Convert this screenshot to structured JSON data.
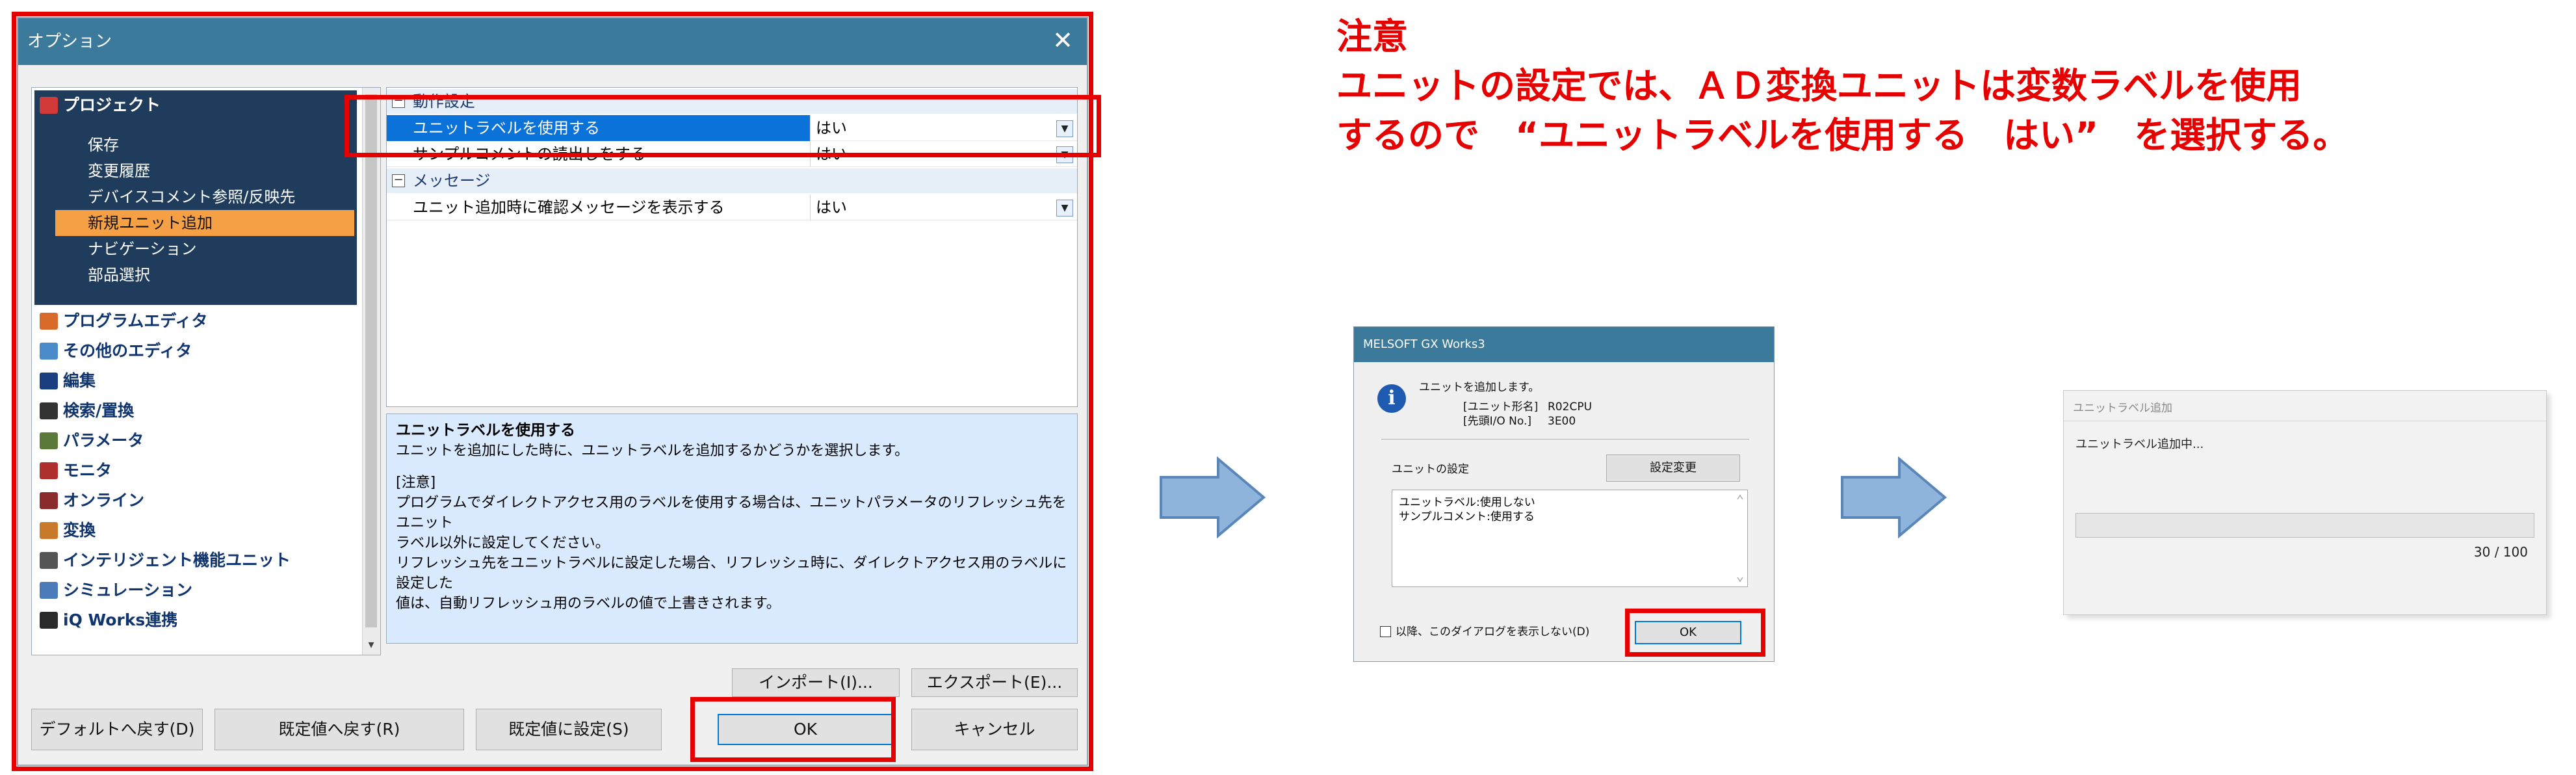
{
  "options_dialog": {
    "title": "オプション",
    "tree": {
      "project": "プロジェクト",
      "project_items": [
        "保存",
        "変更履歴",
        "デバイスコメント参照/反映先",
        "新規ユニット追加",
        "ナビゲーション",
        "部品選択"
      ],
      "selected_item": "新規ユニット追加",
      "categories": [
        "プログラムエディタ",
        "その他のエディタ",
        "編集",
        "検索/置換",
        "パラメータ",
        "モニタ",
        "オンライン",
        "変換",
        "インテリジェント機能ユニット",
        "シミュレーション",
        "iQ Works連携"
      ]
    },
    "grid": {
      "section1": "動作設定",
      "rows1": [
        {
          "name": "ユニットラベルを使用する",
          "value": "はい"
        },
        {
          "name": "サンプルコメントの読出しをする",
          "value": "はい"
        }
      ],
      "section2": "メッセージ",
      "rows2": [
        {
          "name": "ユニット追加時に確認メッセージを表示する",
          "value": "はい"
        }
      ]
    },
    "description": {
      "title": "ユニットラベルを使用する",
      "line1": "ユニットを追加にした時に、ユニットラベルを追加するかどうかを選択します。",
      "line2": "[注意]",
      "line3": "プログラムでダイレクトアクセス用のラベルを使用する場合は、ユニットパラメータのリフレッシュ先をユニット",
      "line4": "ラベル以外に設定してください。",
      "line5": "リフレッシュ先をユニットラベルに設定した場合、リフレッシュ時に、ダイレクトアクセス用のラベルに設定した",
      "line6": "値は、自動リフレッシュ用のラベルの値で上書きされます。"
    },
    "buttons": {
      "import": "インポート(I)...",
      "export": "エクスポート(E)...",
      "reset_default": "デフォルトへ戻す(D)",
      "restore_preset": "既定値へ戻す(R)",
      "set_preset": "既定値に設定(S)",
      "ok": "OK",
      "cancel": "キャンセル"
    }
  },
  "note": {
    "heading": "注意",
    "line1": "ユニットの設定では、ＡＤ変換ユニットは変数ラベルを使用",
    "line2": "するので　“ユニットラベルを使用する　はい”　を選択する。"
  },
  "melsoft_dialog": {
    "title": "MELSOFT GX Works3",
    "message": "ユニットを追加します。",
    "model_label": "[ユニット形名]",
    "model_value": "R02CPU",
    "io_label": "[先頭I/O No.]",
    "io_value": "3E00",
    "settings_label": "ユニットの設定",
    "change_button": "設定変更",
    "box_line1": "ユニットラベル:使用しない",
    "box_line2": "サンプルコメント:使用する",
    "checkbox_label": "以降、このダイアログを表示しない(D)",
    "ok": "OK"
  },
  "progress_dialog": {
    "title": "ユニットラベル追加",
    "message": "ユニットラベル追加中...",
    "progress": 0.3,
    "count": "30 / 100"
  },
  "colors": {
    "annotation_red": "#e60000",
    "title_bar": "#3c7a9c",
    "selection_orange": "#f5a044",
    "selection_blue": "#0a72d8",
    "arrow_blue": "#8fb4dc"
  }
}
